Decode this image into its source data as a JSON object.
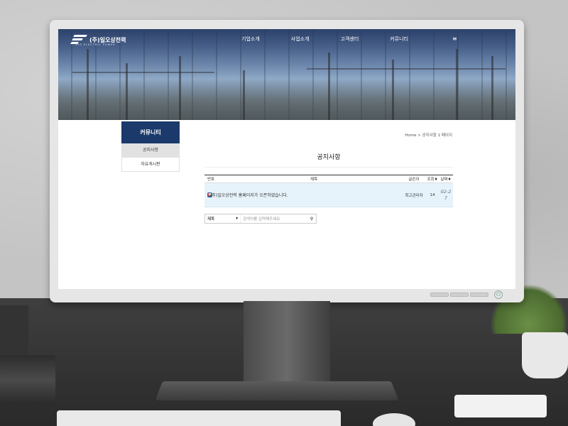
{
  "site": {
    "logo_text": "(주)일오상전력",
    "logo_sub": "150 ELECTRIC POWER"
  },
  "nav": {
    "items": [
      "기업소개",
      "사업소개",
      "고객센터",
      "커뮤니티"
    ]
  },
  "sidebar": {
    "title": "커뮤니티",
    "items": [
      {
        "label": "공지사항",
        "active": true
      },
      {
        "label": "자유게시판",
        "active": false
      }
    ]
  },
  "breadcrumb": "Home > 공지사항 1 페이지",
  "page_title": "공지사항",
  "table": {
    "headers": {
      "num": "번호",
      "subject": "제목",
      "author": "글쓴이",
      "hits": "조회",
      "date": "날짜"
    },
    "rows": [
      {
        "subject": "(주)일오상전력 홈페이지가 오픈하였습니다.",
        "author": "최고관리자",
        "hits": "14",
        "date_line1": "02-2",
        "date_line2": "7"
      }
    ]
  },
  "search": {
    "field": "제목",
    "placeholder": "검색어를 입력해주세요"
  },
  "colors": {
    "sidebar_title_bg": "#1b3a6b",
    "notice_row_bg": "#e6f3fb"
  }
}
